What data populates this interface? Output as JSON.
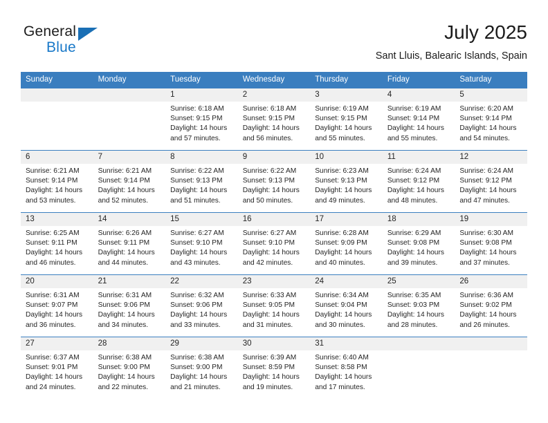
{
  "brand": {
    "word_one": "General",
    "word_two": "Blue",
    "logo_icon": "triangle-logo-icon",
    "accent_color": "#1878c8"
  },
  "header": {
    "title": "July 2025",
    "location": "Sant Lluis, Balearic Islands, Spain"
  },
  "calendar": {
    "header_bg": "#3a7ebf",
    "daynum_bg": "#f0f0f0",
    "weekday_headers": [
      "Sunday",
      "Monday",
      "Tuesday",
      "Wednesday",
      "Thursday",
      "Friday",
      "Saturday"
    ],
    "weeks": [
      [
        {
          "day": "",
          "lines": []
        },
        {
          "day": "",
          "lines": []
        },
        {
          "day": "1",
          "lines": [
            "Sunrise: 6:18 AM",
            "Sunset: 9:15 PM",
            "Daylight: 14 hours",
            "and 57 minutes."
          ]
        },
        {
          "day": "2",
          "lines": [
            "Sunrise: 6:18 AM",
            "Sunset: 9:15 PM",
            "Daylight: 14 hours",
            "and 56 minutes."
          ]
        },
        {
          "day": "3",
          "lines": [
            "Sunrise: 6:19 AM",
            "Sunset: 9:15 PM",
            "Daylight: 14 hours",
            "and 55 minutes."
          ]
        },
        {
          "day": "4",
          "lines": [
            "Sunrise: 6:19 AM",
            "Sunset: 9:14 PM",
            "Daylight: 14 hours",
            "and 55 minutes."
          ]
        },
        {
          "day": "5",
          "lines": [
            "Sunrise: 6:20 AM",
            "Sunset: 9:14 PM",
            "Daylight: 14 hours",
            "and 54 minutes."
          ]
        }
      ],
      [
        {
          "day": "6",
          "lines": [
            "Sunrise: 6:21 AM",
            "Sunset: 9:14 PM",
            "Daylight: 14 hours",
            "and 53 minutes."
          ]
        },
        {
          "day": "7",
          "lines": [
            "Sunrise: 6:21 AM",
            "Sunset: 9:14 PM",
            "Daylight: 14 hours",
            "and 52 minutes."
          ]
        },
        {
          "day": "8",
          "lines": [
            "Sunrise: 6:22 AM",
            "Sunset: 9:13 PM",
            "Daylight: 14 hours",
            "and 51 minutes."
          ]
        },
        {
          "day": "9",
          "lines": [
            "Sunrise: 6:22 AM",
            "Sunset: 9:13 PM",
            "Daylight: 14 hours",
            "and 50 minutes."
          ]
        },
        {
          "day": "10",
          "lines": [
            "Sunrise: 6:23 AM",
            "Sunset: 9:13 PM",
            "Daylight: 14 hours",
            "and 49 minutes."
          ]
        },
        {
          "day": "11",
          "lines": [
            "Sunrise: 6:24 AM",
            "Sunset: 9:12 PM",
            "Daylight: 14 hours",
            "and 48 minutes."
          ]
        },
        {
          "day": "12",
          "lines": [
            "Sunrise: 6:24 AM",
            "Sunset: 9:12 PM",
            "Daylight: 14 hours",
            "and 47 minutes."
          ]
        }
      ],
      [
        {
          "day": "13",
          "lines": [
            "Sunrise: 6:25 AM",
            "Sunset: 9:11 PM",
            "Daylight: 14 hours",
            "and 46 minutes."
          ]
        },
        {
          "day": "14",
          "lines": [
            "Sunrise: 6:26 AM",
            "Sunset: 9:11 PM",
            "Daylight: 14 hours",
            "and 44 minutes."
          ]
        },
        {
          "day": "15",
          "lines": [
            "Sunrise: 6:27 AM",
            "Sunset: 9:10 PM",
            "Daylight: 14 hours",
            "and 43 minutes."
          ]
        },
        {
          "day": "16",
          "lines": [
            "Sunrise: 6:27 AM",
            "Sunset: 9:10 PM",
            "Daylight: 14 hours",
            "and 42 minutes."
          ]
        },
        {
          "day": "17",
          "lines": [
            "Sunrise: 6:28 AM",
            "Sunset: 9:09 PM",
            "Daylight: 14 hours",
            "and 40 minutes."
          ]
        },
        {
          "day": "18",
          "lines": [
            "Sunrise: 6:29 AM",
            "Sunset: 9:08 PM",
            "Daylight: 14 hours",
            "and 39 minutes."
          ]
        },
        {
          "day": "19",
          "lines": [
            "Sunrise: 6:30 AM",
            "Sunset: 9:08 PM",
            "Daylight: 14 hours",
            "and 37 minutes."
          ]
        }
      ],
      [
        {
          "day": "20",
          "lines": [
            "Sunrise: 6:31 AM",
            "Sunset: 9:07 PM",
            "Daylight: 14 hours",
            "and 36 minutes."
          ]
        },
        {
          "day": "21",
          "lines": [
            "Sunrise: 6:31 AM",
            "Sunset: 9:06 PM",
            "Daylight: 14 hours",
            "and 34 minutes."
          ]
        },
        {
          "day": "22",
          "lines": [
            "Sunrise: 6:32 AM",
            "Sunset: 9:06 PM",
            "Daylight: 14 hours",
            "and 33 minutes."
          ]
        },
        {
          "day": "23",
          "lines": [
            "Sunrise: 6:33 AM",
            "Sunset: 9:05 PM",
            "Daylight: 14 hours",
            "and 31 minutes."
          ]
        },
        {
          "day": "24",
          "lines": [
            "Sunrise: 6:34 AM",
            "Sunset: 9:04 PM",
            "Daylight: 14 hours",
            "and 30 minutes."
          ]
        },
        {
          "day": "25",
          "lines": [
            "Sunrise: 6:35 AM",
            "Sunset: 9:03 PM",
            "Daylight: 14 hours",
            "and 28 minutes."
          ]
        },
        {
          "day": "26",
          "lines": [
            "Sunrise: 6:36 AM",
            "Sunset: 9:02 PM",
            "Daylight: 14 hours",
            "and 26 minutes."
          ]
        }
      ],
      [
        {
          "day": "27",
          "lines": [
            "Sunrise: 6:37 AM",
            "Sunset: 9:01 PM",
            "Daylight: 14 hours",
            "and 24 minutes."
          ]
        },
        {
          "day": "28",
          "lines": [
            "Sunrise: 6:38 AM",
            "Sunset: 9:00 PM",
            "Daylight: 14 hours",
            "and 22 minutes."
          ]
        },
        {
          "day": "29",
          "lines": [
            "Sunrise: 6:38 AM",
            "Sunset: 9:00 PM",
            "Daylight: 14 hours",
            "and 21 minutes."
          ]
        },
        {
          "day": "30",
          "lines": [
            "Sunrise: 6:39 AM",
            "Sunset: 8:59 PM",
            "Daylight: 14 hours",
            "and 19 minutes."
          ]
        },
        {
          "day": "31",
          "lines": [
            "Sunrise: 6:40 AM",
            "Sunset: 8:58 PM",
            "Daylight: 14 hours",
            "and 17 minutes."
          ]
        },
        {
          "day": "",
          "lines": []
        },
        {
          "day": "",
          "lines": []
        }
      ]
    ]
  }
}
